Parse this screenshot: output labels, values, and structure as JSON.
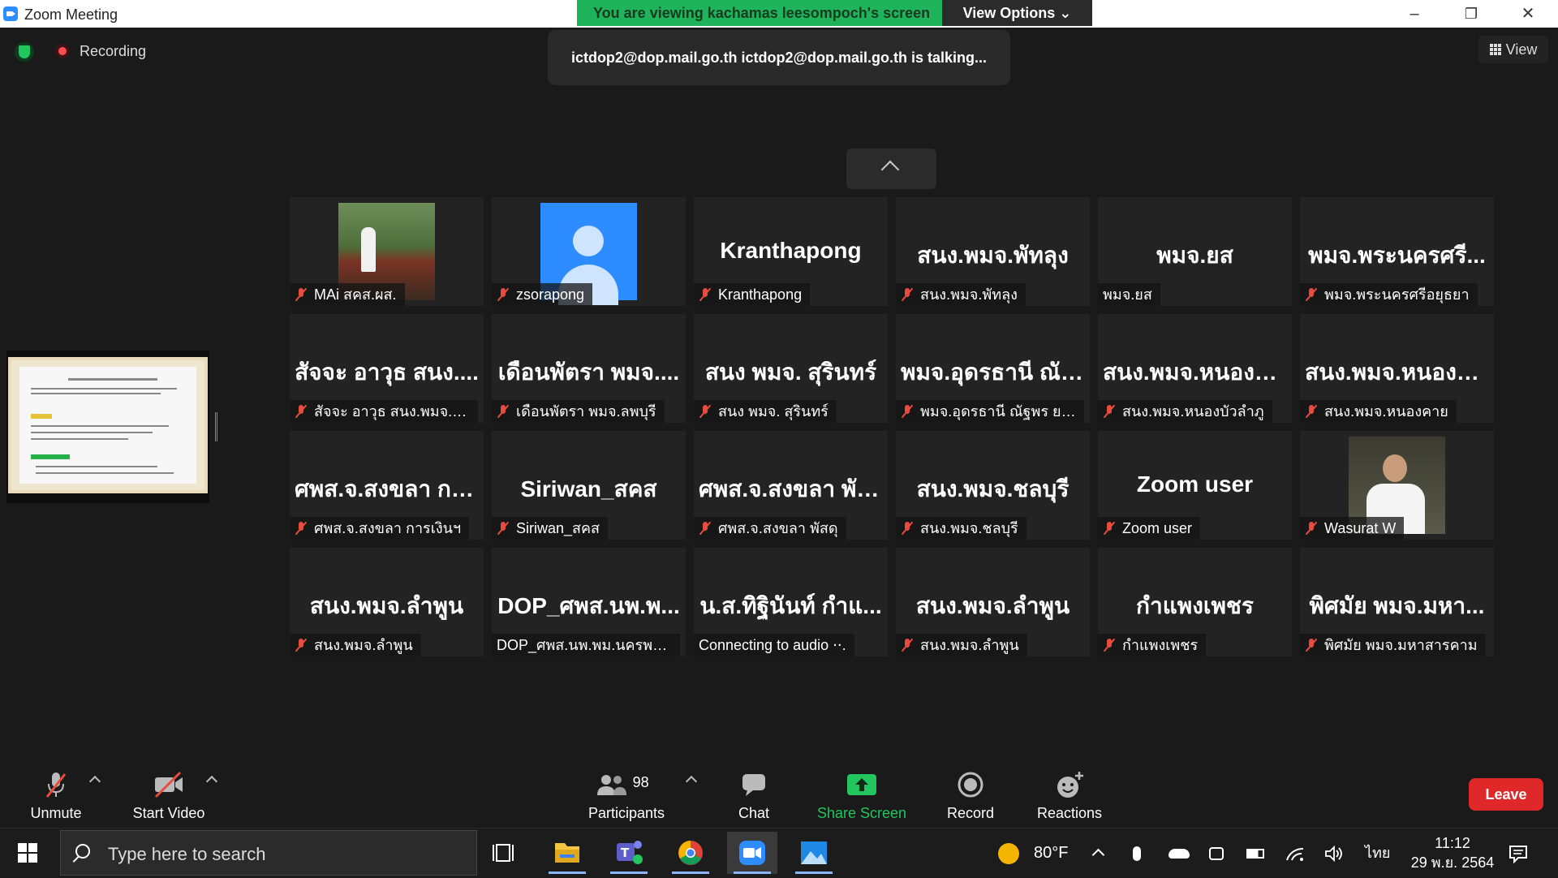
{
  "window": {
    "title": "Zoom Meeting"
  },
  "banner": {
    "message": "You are viewing kachamas leesompoch's screen",
    "view_options": "View Options ⌄"
  },
  "header": {
    "recording": "Recording",
    "talking": "ictdop2@dop.mail.go.th ictdop2@dop.mail.go.th is talking...",
    "view": "View"
  },
  "participants": [
    {
      "big": "",
      "name": "MAi สคส.ผส.",
      "muted": true,
      "video": "photo1"
    },
    {
      "big": "",
      "name": "zsorapong",
      "muted": true,
      "video": "avatar"
    },
    {
      "big": "Kranthapong",
      "name": "Kranthapong",
      "muted": true
    },
    {
      "big": "สนง.พมจ.พัทลุง",
      "name": "สนง.พมจ.พัทลุง",
      "muted": true
    },
    {
      "big": "พมจ.ยส",
      "name": "พมจ.ยส",
      "muted": false
    },
    {
      "big": "พมจ.พระนครศรี...",
      "name": "พมจ.พระนครศรีอยุธยา",
      "muted": true
    },
    {
      "big": "สัจจะ อาวุธ สนง....",
      "name": "สัจจะ อาวุธ สนง.พมจ.สฎ",
      "muted": true
    },
    {
      "big": "เดือนพัตรา พมจ....",
      "name": "เดือนพัตรา พมจ.ลพบุรี",
      "muted": true
    },
    {
      "big": "สนง พมจ. สุรินทร์",
      "name": "สนง พมจ. สุรินทร์",
      "muted": true
    },
    {
      "big": "พมจ.อุดรธานี ณัฐ...",
      "name": "พมจ.อุดรธานี ณัฐพร ยศสู...",
      "muted": true
    },
    {
      "big": "สนง.พมจ.หนองบั...",
      "name": "สนง.พมจ.หนองบัวลำภู",
      "muted": true
    },
    {
      "big": "สนง.พมจ.หนองค...",
      "name": "สนง.พมจ.หนองคาย",
      "muted": true
    },
    {
      "big": "ศพส.จ.สงขลา กา...",
      "name": "ศพส.จ.สงขลา การเงินฯ",
      "muted": true
    },
    {
      "big": "Siriwan_สคส",
      "name": "Siriwan_สคส",
      "muted": true
    },
    {
      "big": "ศพส.จ.สงขลา พัสดุ",
      "name": "ศพส.จ.สงขลา พัสดุ",
      "muted": true
    },
    {
      "big": "สนง.พมจ.ชลบุรี",
      "name": "สนง.พมจ.ชลบุรี",
      "muted": true
    },
    {
      "big": "Zoom user",
      "name": "Zoom user",
      "muted": true
    },
    {
      "big": "",
      "name": "Wasurat W",
      "muted": true,
      "video": "photo2"
    },
    {
      "big": "สนง.พมจ.ลำพูน",
      "name": "สนง.พมจ.ลำพูน",
      "muted": true
    },
    {
      "big": "DOP_ศพส.นพ.พ...",
      "name": "DOP_ศพส.นพ.พม.นครพนม",
      "muted": false
    },
    {
      "big": "น.ส.ทิฐินันท์ กำแ...",
      "name": "Connecting to audio ⋅⋅.",
      "muted": false
    },
    {
      "big": "สนง.พมจ.ลำพูน",
      "name": "สนง.พมจ.ลำพูน",
      "muted": true
    },
    {
      "big": "กำแพงเพชร",
      "name": "กำแพงเพชร",
      "muted": true
    },
    {
      "big": "พิศมัย  พมจ.มหา...",
      "name": "พิศมัย  พมจ.มหาสารคาม",
      "muted": true
    }
  ],
  "controls": {
    "unmute": "Unmute",
    "start_video": "Start Video",
    "participants_count": "98",
    "participants": "Participants",
    "chat": "Chat",
    "share_screen": "Share Screen",
    "record": "Record",
    "reactions": "Reactions",
    "leave": "Leave"
  },
  "taskbar": {
    "search_placeholder": "Type here to search",
    "temperature": "80°F",
    "language": "ไทย",
    "time": "11:12",
    "date": "29 พ.ย. 2564"
  },
  "colors": {
    "accent": "#2D8CFF",
    "banner_green": "#1fb35b",
    "leave_red": "#e02828",
    "share_green": "#22c55e"
  }
}
